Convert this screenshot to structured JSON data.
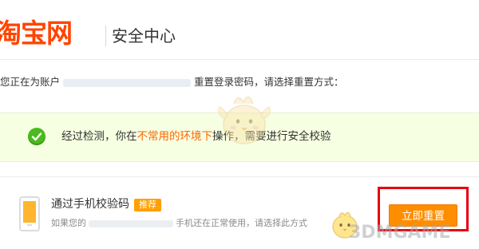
{
  "header": {
    "logo_text": "淘宝网",
    "page_title": "安全中心"
  },
  "account": {
    "prefix": "您正在为账户",
    "suffix": "重置登录密码，请选择重置方式："
  },
  "notice": {
    "text_before": "经过检测，你在",
    "highlight": "不常用的环境下",
    "text_after": "操作，需要进行安全校验"
  },
  "methods": [
    {
      "icon": "phone-icon",
      "title": "通过手机校验码",
      "badge": "推荐",
      "desc_before": "如果您的",
      "desc_after": "手机还在正常使用，请选择此方式",
      "button_label": "立即重置"
    }
  ],
  "watermark": "3DMGAME",
  "colors": {
    "brand": "#ff4400",
    "accent": "#ff8d00",
    "notice_bg": "#f6ffe1",
    "success": "#4cb91e",
    "highlight_border": "#e60012"
  }
}
